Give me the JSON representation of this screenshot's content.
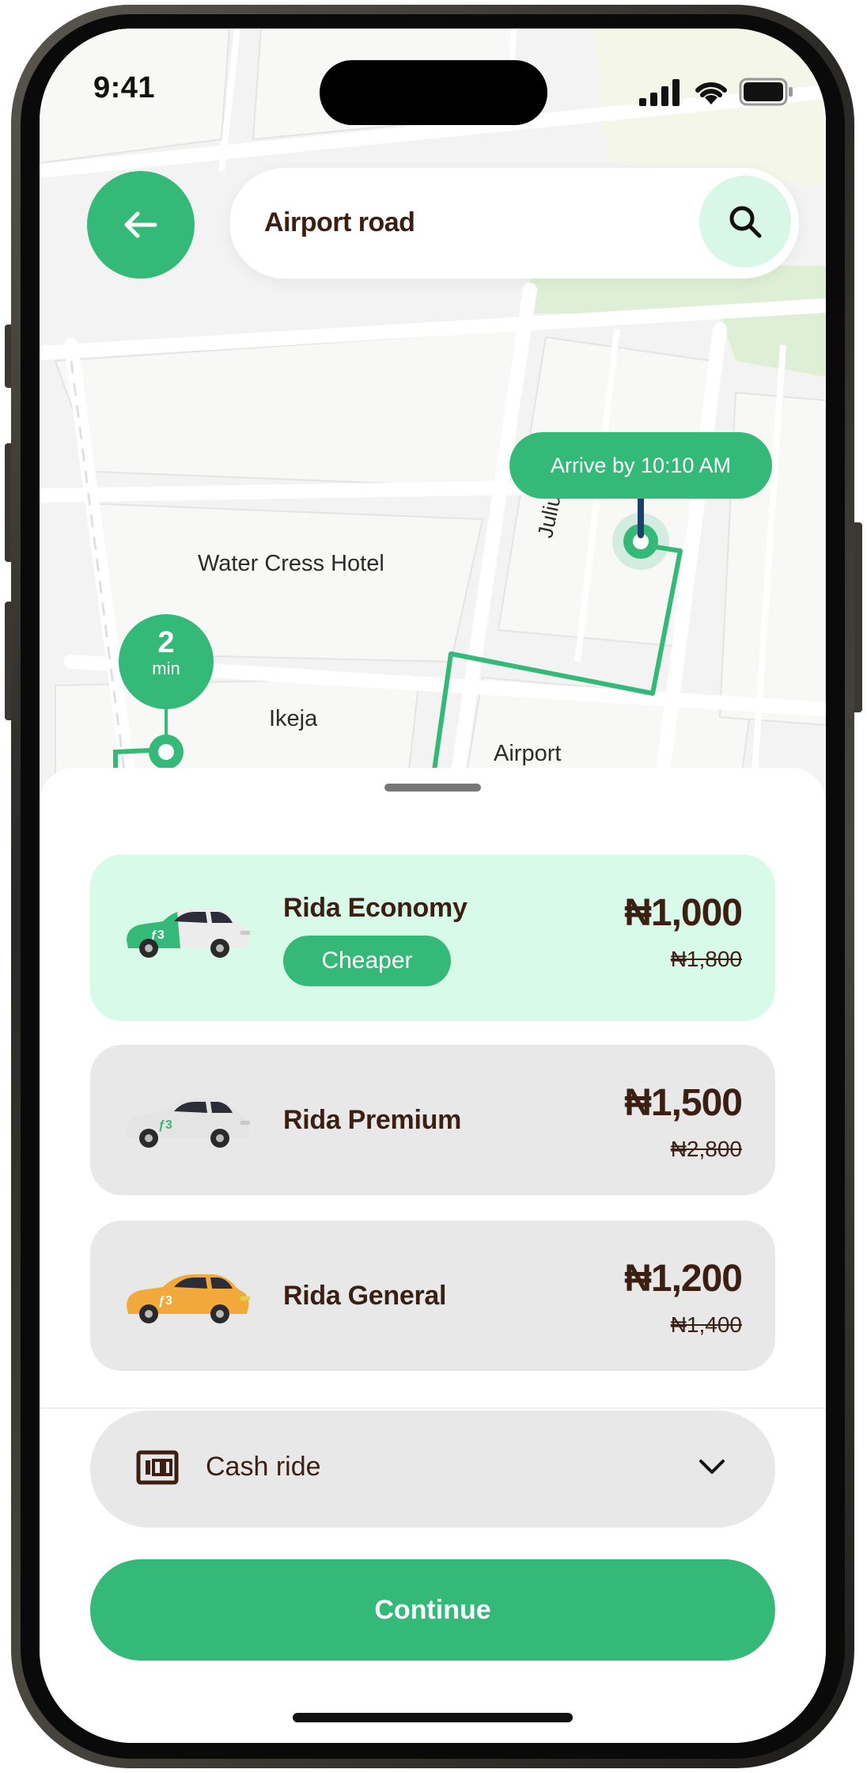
{
  "status_bar": {
    "time": "9:41"
  },
  "search": {
    "query": "Airport road"
  },
  "map": {
    "labels": {
      "hotel": "Water Cress Hotel",
      "area": "Ikeja",
      "airport": "Airport",
      "street": "Julius b"
    },
    "arrive": "Arrive by 10:10 AM",
    "eta": {
      "value": "2",
      "unit": "min"
    }
  },
  "rides": [
    {
      "name": "Rida Economy",
      "badge": "Cheaper",
      "price": "₦1,000",
      "old_price": "₦1,800",
      "car_color": "#ececec",
      "accent": "#34b978"
    },
    {
      "name": "Rida Premium",
      "price": "₦1,500",
      "old_price": "₦2,800",
      "car_color": "#e4e4e4",
      "accent": "#34b978"
    },
    {
      "name": "Rida General",
      "price": "₦1,200",
      "old_price": "₦1,400",
      "car_color": "#f2a93b",
      "accent": "#f2a93b"
    }
  ],
  "payment": {
    "method": "Cash ride",
    "icon": "cash-icon"
  },
  "actions": {
    "continue": "Continue"
  },
  "colors": {
    "brand": "#34b978",
    "brand_light": "#d8fbe9",
    "text_dark": "#3b1f12"
  }
}
